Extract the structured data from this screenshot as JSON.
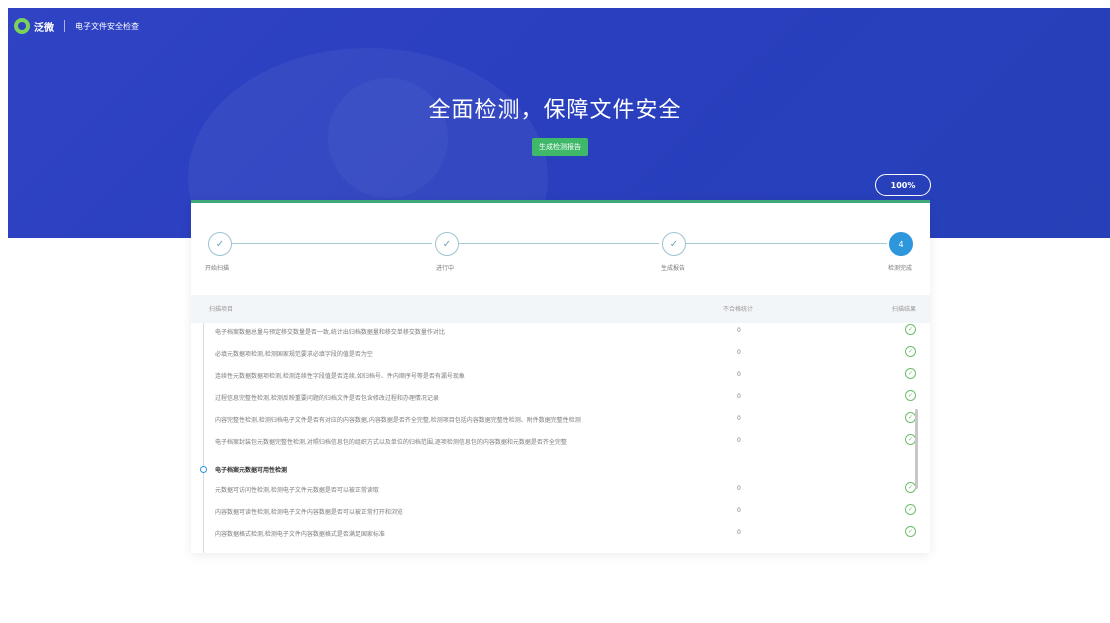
{
  "header": {
    "logo_text": "泛微",
    "app_title": "电子文件安全检查"
  },
  "hero": {
    "title": "全面检测，保障文件安全",
    "report_button": "生成检测报告",
    "progress": "100%"
  },
  "steps": [
    {
      "label": "开始扫描",
      "state": "done",
      "glyph": "✓"
    },
    {
      "label": "进行中",
      "state": "done",
      "glyph": "✓"
    },
    {
      "label": "生成报告",
      "state": "done",
      "glyph": "✓"
    },
    {
      "label": "检测完成",
      "state": "active",
      "glyph": "4"
    }
  ],
  "table": {
    "headers": {
      "item": "扫描项目",
      "count": "不合格统计",
      "result": "扫描结果"
    },
    "rows_a": [
      {
        "name": "电子档案数据总量与预定移交数量是否一致,统计出归档数据量和移交单移交数量作对比",
        "count": "0"
      },
      {
        "name": "必填元数据项检测,检测国家规范要求必填字段的值是否为空",
        "count": "0"
      },
      {
        "name": "连续性元数据数据项检测,检测连续性字段值是否连续,如归档号、件内顺序号等是否有漏号现象",
        "count": "0"
      },
      {
        "name": "过程信息完整性检测,检测反映重要问题的归档文件是否包含修改过程和办理情况记录",
        "count": "0"
      },
      {
        "name": "内容完整性检测,检测归档电子文件是否有对应的内容数据,内容数据是否齐全完整,检测项目包括内容数据完整性检测、附件数据完整性检测",
        "count": "0"
      },
      {
        "name": "电子档案封装包元数据完整性检测,对照归档信息包的组织方式以及单位的归档范围,逐项检测信息包的内容数据和元数据是否齐全完整",
        "count": "0"
      }
    ],
    "group_title": "电子档案元数据可用性检测",
    "rows_b": [
      {
        "name": "元数据可访问性检测,检测电子文件元数据是否可以被正常读取",
        "count": "0"
      },
      {
        "name": "内容数据可读性检测,检测电子文件内容数据是否可以被正常打开和浏览",
        "count": "0"
      },
      {
        "name": "内容数据格式检测,检测电子文件内容数据格式是否满足国家标准",
        "count": "0"
      }
    ]
  },
  "colors": {
    "hero_blue": "#2a3fbf",
    "accent_green": "#3fb86a",
    "step_active": "#2e96dd",
    "check_green": "#6bbf6a"
  }
}
